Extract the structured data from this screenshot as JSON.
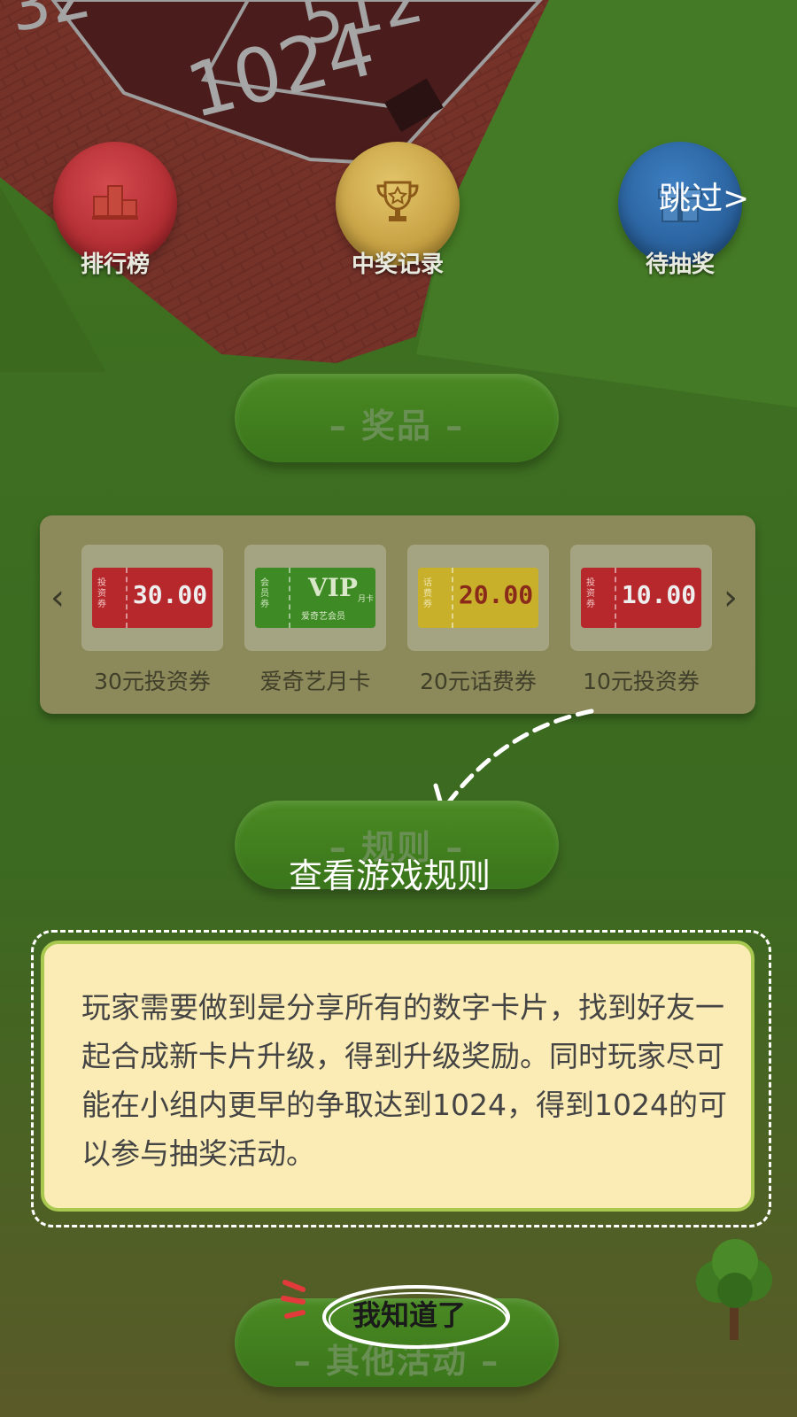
{
  "board": {
    "tile_left": "512",
    "tile_main": "1024",
    "tile_corner": "32"
  },
  "top_buttons": [
    {
      "label": "排行榜",
      "icon": "podium-icon",
      "color": "#b4242a"
    },
    {
      "label": "中奖记录",
      "icon": "trophy-icon",
      "color": "#c9a13a"
    },
    {
      "label": "待抽奖",
      "icon": "gift-icon",
      "color": "#2d6aa6"
    }
  ],
  "skip": {
    "label": "跳过>"
  },
  "sections": {
    "prizes_title": "– 奖品 –",
    "rules_title": "– 规则 –",
    "other_title": "– 其他活动 –"
  },
  "prizes": [
    {
      "name": "30元投资券",
      "amount": "30.00",
      "stub": "投资券",
      "color": "#b7282c"
    },
    {
      "name": "爱奇艺月卡",
      "amount": "VIP",
      "stub": "会员券",
      "sub": "爱奇艺会员",
      "tag": "月卡",
      "color": "#3e8a24"
    },
    {
      "name": "20元话费券",
      "amount": "20.00",
      "stub": "话费券",
      "color": "#c8b02a"
    },
    {
      "name": "10元投资券",
      "amount": "10.00",
      "stub": "投资券",
      "color": "#b7282c"
    }
  ],
  "hint": {
    "text": "查看游戏规则"
  },
  "rules": {
    "text": "玩家需要做到是分享所有的数字卡片，找到好友一起合成新卡片升级，得到升级奖励。同时玩家尽可能在小组内更早的争取达到1024，得到1024的可以参与抽奖活动。"
  },
  "confirm": {
    "label": "我知道了"
  }
}
